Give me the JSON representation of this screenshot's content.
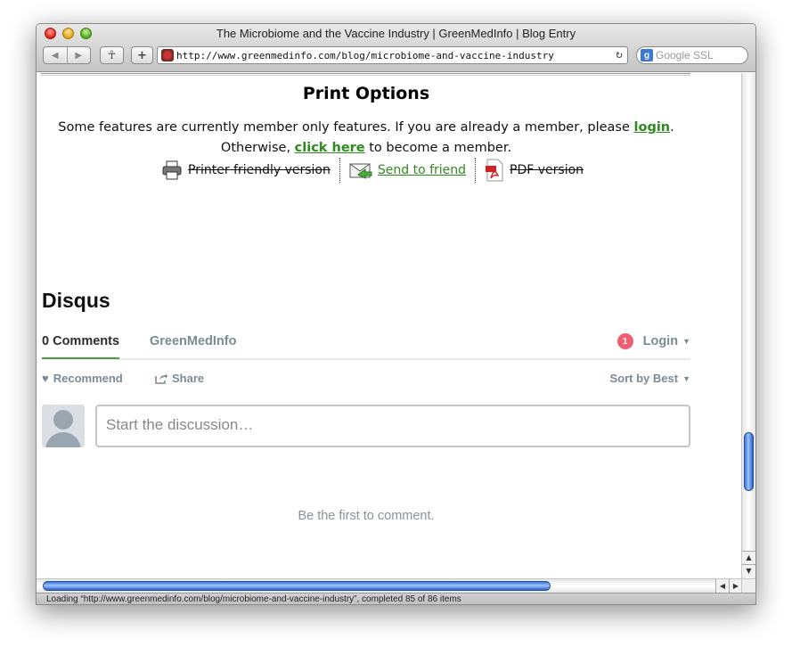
{
  "window": {
    "title": "The Microbiome and the Vaccine Industry | GreenMedInfo | Blog Entry"
  },
  "toolbar": {
    "url": "http://www.greenmedinfo.com/blog/microbiome-and-vaccine-industry",
    "search_placeholder": "Google SSL",
    "back_icon": "back-arrow-icon",
    "forward_icon": "forward-arrow-icon"
  },
  "print": {
    "title": "Print Options",
    "msg_prefix": "Some features are currently member only features. If you are already a member, please ",
    "login_link": "login",
    "msg_mid": ".",
    "msg_line2_prefix": "Otherwise, ",
    "click_here": "click here",
    "msg_line2_suffix": " to become a member.",
    "printer_label": "Printer friendly version",
    "send_label": "Send to friend",
    "pdf_label": "PDF version"
  },
  "disqus": {
    "heading": "Disqus",
    "tab_comments": "0 Comments",
    "tab_site": "GreenMedInfo",
    "notification_count": "1",
    "login_label": "Login",
    "recommend_label": "Recommend",
    "share_label": "Share",
    "sort_label": "Sort by Best",
    "input_placeholder": "Start the discussion…",
    "empty_message": "Be the first to comment."
  },
  "status": {
    "text": "Loading “http://www.greenmedinfo.com/blog/microbiome-and-vaccine-industry”, completed 85 of 86 items"
  },
  "colors": {
    "link_green": "#2e8b1e",
    "badge_red": "#f05f70",
    "scroll_blue": "#3b74d6"
  }
}
